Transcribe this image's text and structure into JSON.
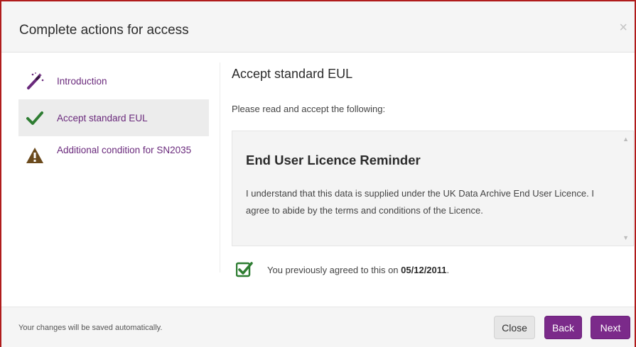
{
  "dialog": {
    "title": "Complete actions for access",
    "close_glyph": "×"
  },
  "sidebar": {
    "steps": [
      {
        "label": "Introduction",
        "icon": "magic-wand-icon",
        "active": false
      },
      {
        "label": "Accept standard EUL",
        "icon": "checkmark-icon",
        "active": true
      },
      {
        "label": "Additional condition for SN2035",
        "icon": "warning-icon",
        "active": false
      }
    ]
  },
  "main": {
    "heading": "Accept standard EUL",
    "instruction": "Please read and accept the following:",
    "licence": {
      "title": "End User Licence Reminder",
      "body": "I understand that this data is supplied under the UK Data Archive End User Licence. I agree to abide by the terms and conditions of the Licence."
    },
    "agreement": {
      "prefix": "You previously agreed to this on ",
      "date": "05/12/2011",
      "suffix": ".",
      "checked": true
    }
  },
  "footer": {
    "note": "Your changes will be saved automatically.",
    "close_label": "Close",
    "back_label": "Back",
    "next_label": "Next"
  },
  "colors": {
    "accent": "#7b2a8a",
    "link": "#6a2a7c",
    "check": "#2e7d32",
    "warning": "#6b4a1c",
    "frame": "#b01c1c"
  }
}
